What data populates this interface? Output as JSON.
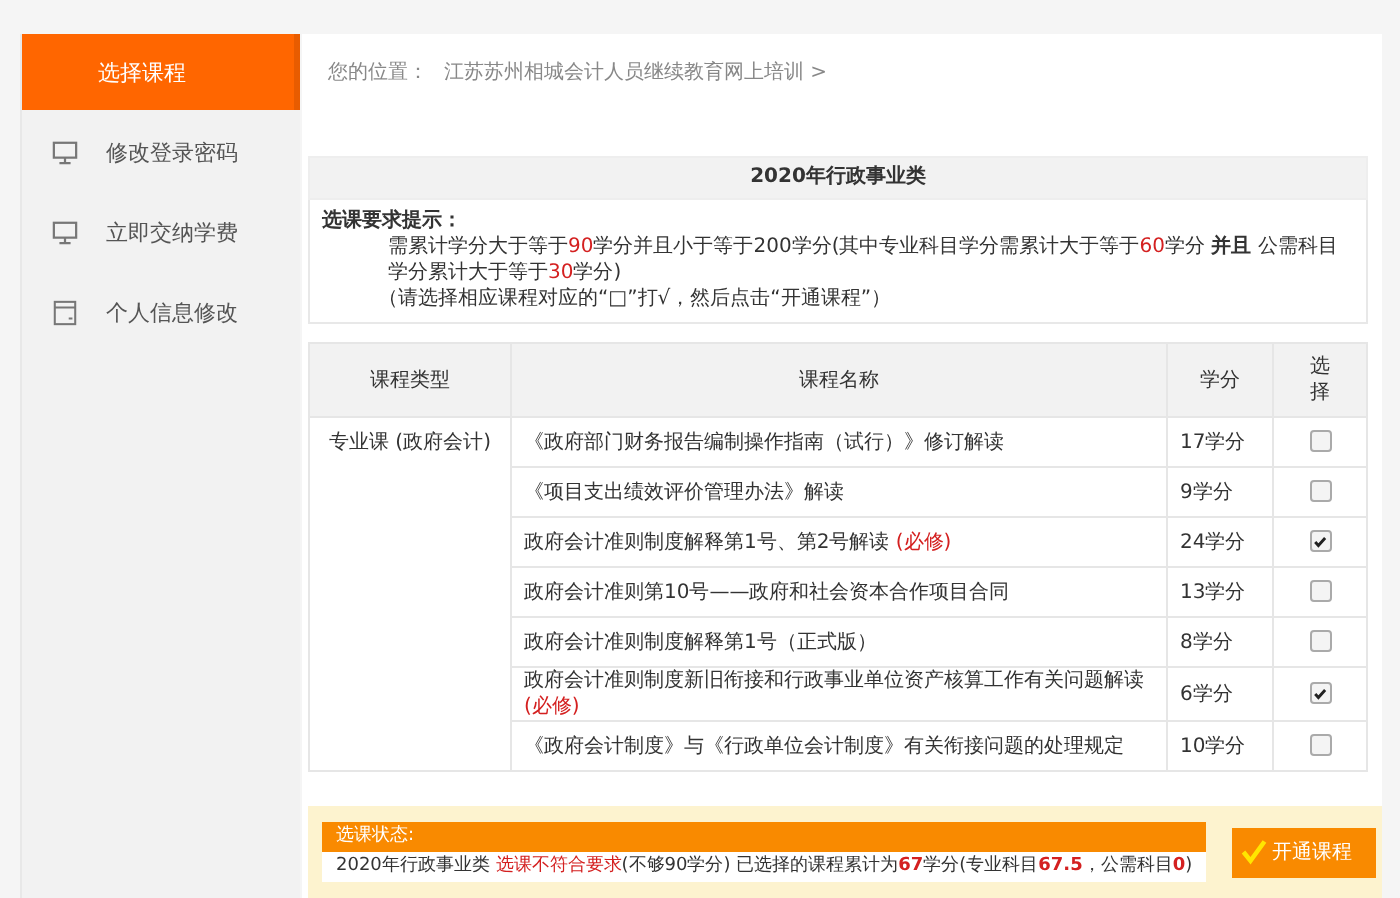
{
  "sidebar": {
    "items": [
      {
        "label": "选择课程",
        "kind": "plain",
        "selected": true
      },
      {
        "label": "修改登录密码",
        "kind": "monitor",
        "selected": false
      },
      {
        "label": "立即交纳学费",
        "kind": "monitor",
        "selected": false
      },
      {
        "label": "个人信息修改",
        "kind": "window",
        "selected": false
      }
    ]
  },
  "breadcrumb": {
    "label": "您的位置：",
    "path": "江苏苏州相城会计人员继续教育网上培训 >"
  },
  "section_title": "2020年行政事业类",
  "requirements": {
    "heading": "选课要求提示：",
    "text": [
      {
        "kind": "plain",
        "text": "需累计学分大于等于"
      },
      {
        "kind": "red",
        "text": "90"
      },
      {
        "kind": "plain",
        "text": "学分并且小于等于200学分(其中专业科目学分需累计大于等于"
      },
      {
        "kind": "red",
        "text": "60"
      },
      {
        "kind": "plain",
        "text": "学分 "
      },
      {
        "kind": "bold",
        "text": "并且"
      },
      {
        "kind": "plain",
        "text": " 公需科目学分累计大于等于"
      },
      {
        "kind": "red",
        "text": "30"
      },
      {
        "kind": "plain",
        "text": "学分)"
      }
    ],
    "note": "（请选择相应课程对应的“□”打√，然后点击“开通课程”）"
  },
  "table": {
    "columns": [
      "课程类型",
      "课程名称",
      "学分",
      "选择"
    ],
    "category": "专业课 (政府会计)",
    "rows": [
      {
        "name": "《政府部门财务报告编制操作指南（试行）》修订解读",
        "credits": "17学分",
        "checked": false
      },
      {
        "name": "《项目支出绩效评价管理办法》解读",
        "credits": "9学分",
        "checked": false
      },
      {
        "name": "政府会计准则制度解释第1号、第2号解读 ",
        "required_tag": "(必修)",
        "credits": "24学分",
        "checked": true
      },
      {
        "name": "政府会计准则第10号——政府和社会资本合作项目合同",
        "credits": "13学分",
        "checked": false
      },
      {
        "name": "政府会计准则制度解释第1号（正式版）",
        "credits": "8学分",
        "checked": false
      },
      {
        "name": "政府会计准则制度新旧衔接和行政事业单位资产核算工作有关问题解读 ",
        "required_tag": "(必修)",
        "credits": "6学分",
        "checked": true
      },
      {
        "name": "《政府会计制度》与《行政单位会计制度》有关衔接问题的处理规定",
        "credits": "10学分",
        "checked": false
      }
    ]
  },
  "status": {
    "label": "选课状态:",
    "text": [
      {
        "kind": "plain",
        "text": "2020年行政事业类 "
      },
      {
        "kind": "red",
        "text": "选课不符合要求"
      },
      {
        "kind": "plain",
        "text": "(不够90学分) 已选择的课程累计为"
      },
      {
        "kind": "boldred",
        "text": "67"
      },
      {
        "kind": "plain",
        "text": "学分(专业科目"
      },
      {
        "kind": "boldred",
        "text": "67.5"
      },
      {
        "kind": "plain",
        "text": "，公需科目"
      },
      {
        "kind": "boldred",
        "text": "0"
      },
      {
        "kind": "plain",
        "text": ")"
      }
    ]
  },
  "button": {
    "label": "开通课程"
  }
}
